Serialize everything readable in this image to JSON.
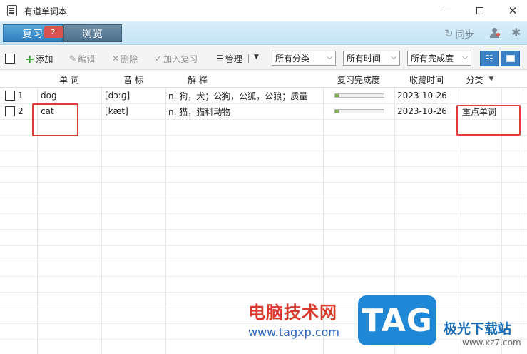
{
  "window": {
    "title": "有道单词本"
  },
  "tabs": {
    "review": "复习",
    "review_badge": "2",
    "browse": "浏览"
  },
  "header_right": {
    "sync_label": "同步"
  },
  "toolbar": {
    "add": "添加",
    "edit": "编辑",
    "delete": "删除",
    "add_review": "加入复习",
    "manage": "管理",
    "filter_category": "所有分类",
    "filter_time": "所有时间",
    "filter_progress": "所有完成度"
  },
  "table": {
    "columns": {
      "word": "单 词",
      "phonetic": "音 标",
      "meaning": "解 释",
      "progress": "复习完成度",
      "time": "收藏时间",
      "category": "分类"
    },
    "rows": [
      {
        "index": "1",
        "word": "dog",
        "phonetic": "[dɔːɡ]",
        "meaning": "n. 狗，犬；公狗，公狐，公狼；质量",
        "progress": 0.08,
        "time": "2023-10-26",
        "category": ""
      },
      {
        "index": "2",
        "word": "cat",
        "phonetic": "[kæt]",
        "meaning": "n. 猫，猫科动物",
        "progress": 0.08,
        "time": "2023-10-26",
        "category": "重点单词"
      }
    ]
  },
  "watermark": {
    "cn": "电脑技术网",
    "url": "www.tagxp.com",
    "tag": "TAG",
    "aurora": "极光下载站",
    "site": "www.xz7.com"
  },
  "colors": {
    "tab_active": "#3b8fd0",
    "badge": "#d9534f",
    "highlight": "#e03a3a",
    "progress_fill": "#7cb342"
  }
}
